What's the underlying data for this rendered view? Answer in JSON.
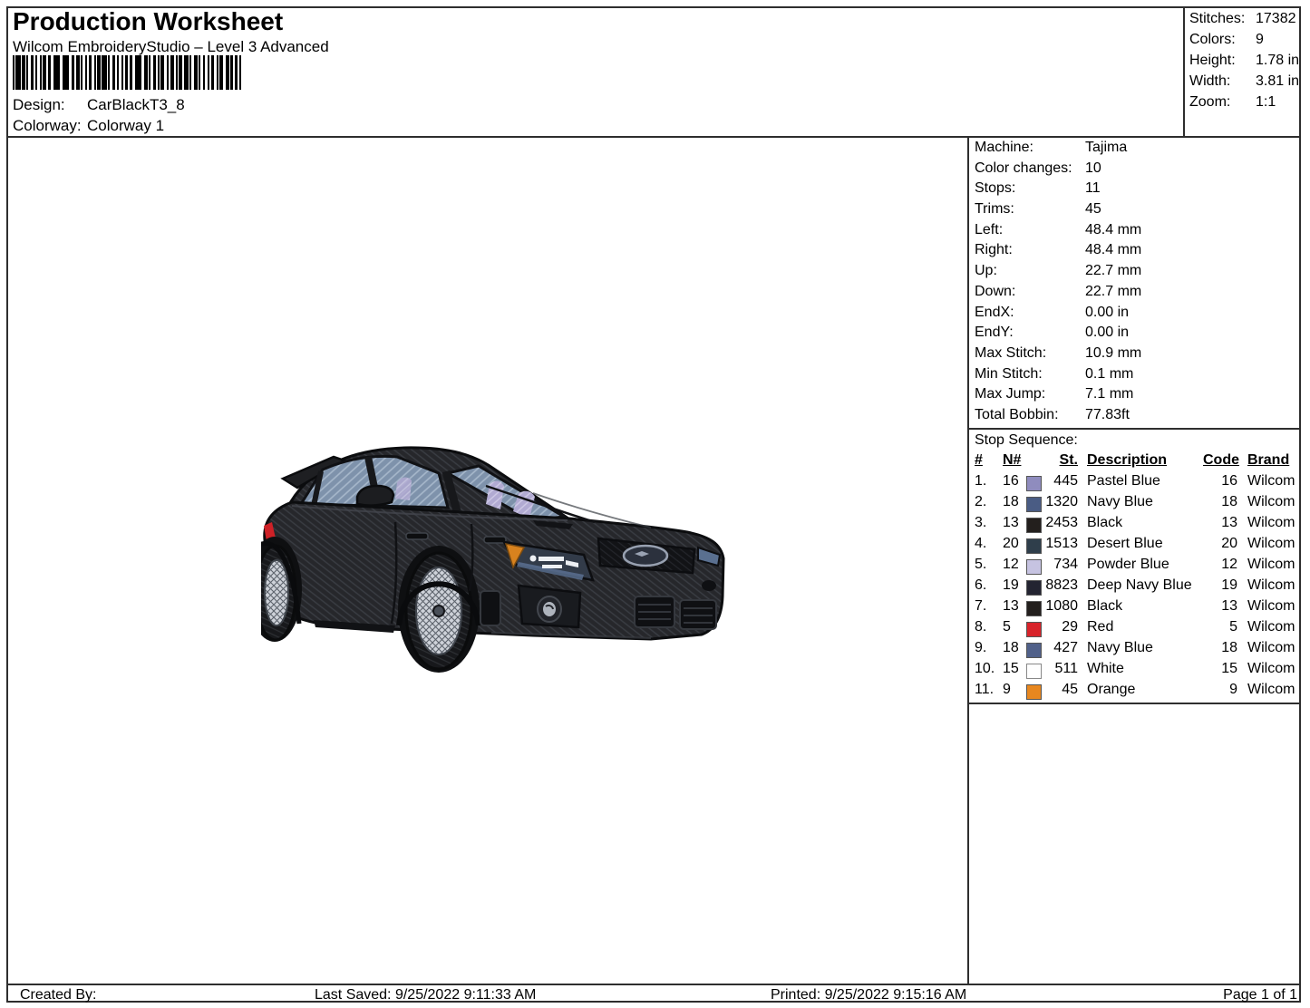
{
  "header": {
    "title": "Production Worksheet",
    "subtitle": "Wilcom EmbroideryStudio – Level 3 Advanced",
    "design_label": "Design:",
    "design_value": "CarBlackT3_8",
    "colorway_label": "Colorway:",
    "colorway_value": "Colorway 1"
  },
  "summary": {
    "rows": [
      {
        "label": "Stitches:",
        "value": "17382"
      },
      {
        "label": "Colors:",
        "value": "9"
      },
      {
        "label": "Height:",
        "value": "1.78 in"
      },
      {
        "label": "Width:",
        "value": "3.81 in"
      },
      {
        "label": "Zoom:",
        "value": "1:1"
      }
    ]
  },
  "machine_info": {
    "rows": [
      {
        "label": "Machine:",
        "value": "Tajima"
      },
      {
        "label": "Color changes:",
        "value": "10"
      },
      {
        "label": "Stops:",
        "value": "11"
      },
      {
        "label": "Trims:",
        "value": "45"
      },
      {
        "label": "Left:",
        "value": "48.4 mm"
      },
      {
        "label": "Right:",
        "value": "48.4 mm"
      },
      {
        "label": "Up:",
        "value": "22.7 mm"
      },
      {
        "label": "Down:",
        "value": "22.7 mm"
      },
      {
        "label": "EndX:",
        "value": "0.00 in"
      },
      {
        "label": "EndY:",
        "value": "0.00 in"
      },
      {
        "label": "Max Stitch:",
        "value": "10.9 mm"
      },
      {
        "label": "Min Stitch:",
        "value": "0.1 mm"
      },
      {
        "label": "Max Jump:",
        "value": "7.1 mm"
      },
      {
        "label": "Total Bobbin:",
        "value": "77.83ft"
      }
    ]
  },
  "stop_sequence": {
    "title": "Stop Sequence:",
    "columns": {
      "num": "#",
      "needle": "N#",
      "stitches": "St.",
      "description": "Description",
      "code": "Code",
      "brand": "Brand"
    },
    "rows": [
      {
        "num": "1.",
        "needle": "16",
        "swatch": "#8F8CBE",
        "stitches": "445",
        "description": "Pastel Blue",
        "code": "16",
        "brand": "Wilcom"
      },
      {
        "num": "2.",
        "needle": "18",
        "swatch": "#4A5C84",
        "stitches": "1320",
        "description": "Navy Blue",
        "code": "18",
        "brand": "Wilcom"
      },
      {
        "num": "3.",
        "needle": "13",
        "swatch": "#231F1D",
        "stitches": "2453",
        "description": "Black",
        "code": "13",
        "brand": "Wilcom"
      },
      {
        "num": "4.",
        "needle": "20",
        "swatch": "#2F3E4B",
        "stitches": "1513",
        "description": "Desert Blue",
        "code": "20",
        "brand": "Wilcom"
      },
      {
        "num": "5.",
        "needle": "12",
        "swatch": "#C6C3E1",
        "stitches": "734",
        "description": "Powder Blue",
        "code": "12",
        "brand": "Wilcom"
      },
      {
        "num": "6.",
        "needle": "19",
        "swatch": "#232431",
        "stitches": "8823",
        "description": "Deep Navy Blue",
        "code": "19",
        "brand": "Wilcom"
      },
      {
        "num": "7.",
        "needle": "13",
        "swatch": "#231F1D",
        "stitches": "1080",
        "description": "Black",
        "code": "13",
        "brand": "Wilcom"
      },
      {
        "num": "8.",
        "needle": "5",
        "swatch": "#D8232A",
        "stitches": "29",
        "description": "Red",
        "code": "5",
        "brand": "Wilcom"
      },
      {
        "num": "9.",
        "needle": "18",
        "swatch": "#51618A",
        "stitches": "427",
        "description": "Navy Blue",
        "code": "18",
        "brand": "Wilcom"
      },
      {
        "num": "10.",
        "needle": "15",
        "swatch": "#FFFFFF",
        "stitches": "511",
        "description": "White",
        "code": "15",
        "brand": "Wilcom"
      },
      {
        "num": "11.",
        "needle": "9",
        "swatch": "#E8871F",
        "stitches": "45",
        "description": "Orange",
        "code": "9",
        "brand": "Wilcom"
      }
    ]
  },
  "footer": {
    "created_by": "Created By:",
    "last_saved": "Last Saved: 9/25/2022 9:11:33 AM",
    "printed": "Printed: 9/25/2022 9:15:16 AM",
    "page": "Page 1 of 1"
  },
  "artwork": {
    "description": "Embroidered black Subaru WRX STI hatchback, front three-quarter view, blue-gray glass, silver mesh wheels"
  }
}
